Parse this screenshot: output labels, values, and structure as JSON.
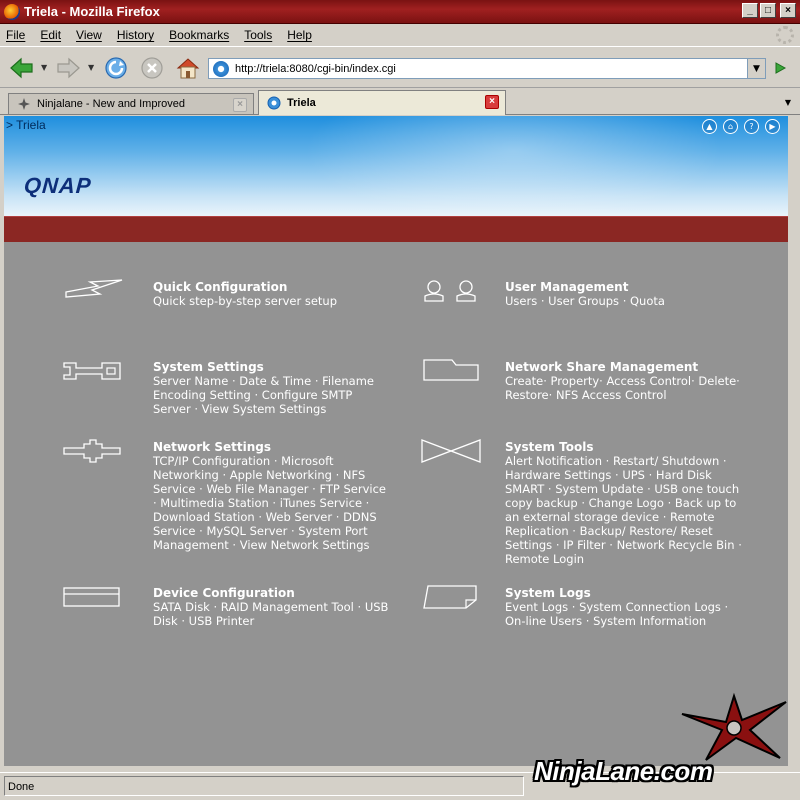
{
  "window": {
    "title": "Triela - Mozilla Firefox",
    "controls": [
      "_",
      "□",
      "×"
    ]
  },
  "menu": {
    "items": [
      "File",
      "Edit",
      "View",
      "History",
      "Bookmarks",
      "Tools",
      "Help"
    ]
  },
  "navbar": {
    "url": "http://triela:8080/cgi-bin/index.cgi"
  },
  "tabs": [
    {
      "label": "Ninjalane - New and Improved",
      "active": false
    },
    {
      "label": "Triela",
      "active": true
    }
  ],
  "page": {
    "breadcrumb": "> Triela",
    "brand": "QNAP",
    "accent_color": "#8b2723",
    "sections": [
      {
        "title": "Quick Configuration",
        "links": "Quick step-by-step server setup",
        "icon": "lightning-icon"
      },
      {
        "title": "User Management",
        "links": "Users · User Groups · Quota",
        "icon": "users-icon"
      },
      {
        "title": "System Settings",
        "links": "Server Name · Date & Time · Filename Encoding Setting · Configure SMTP Server · View System Settings",
        "icon": "wrench-icon"
      },
      {
        "title": "Network Share Management",
        "links": "Create· Property· Access Control· Delete· Restore· NFS Access Control",
        "icon": "folder-icon"
      },
      {
        "title": "Network Settings",
        "links": "TCP/IP Configuration · Microsoft Networking · Apple Networking · NFS Service · Web File Manager · FTP Service · Multimedia Station · iTunes Service · Download Station · Web Server · DDNS Service · MySQL Server · System Port Management · View Network Settings",
        "icon": "network-icon"
      },
      {
        "title": "System Tools",
        "links": "Alert Notification · Restart/ Shutdown · Hardware Settings · UPS · Hard Disk SMART · System Update · USB one touch copy backup · Change Logo · Back up to an external storage device · Remote Replication · Backup/ Restore/ Reset Settings · IP Filter · Network Recycle Bin · Remote Login",
        "icon": "tools-icon"
      },
      {
        "title": "Device Configuration",
        "links": "SATA Disk · RAID Management Tool · USB Disk · USB Printer",
        "icon": "device-icon"
      },
      {
        "title": "System Logs",
        "links": "Event Logs · System Connection Logs · On-line Users · System Information",
        "icon": "log-icon"
      }
    ]
  },
  "status": {
    "text": "Done"
  },
  "watermark": {
    "text": "NinjaLane.com"
  }
}
